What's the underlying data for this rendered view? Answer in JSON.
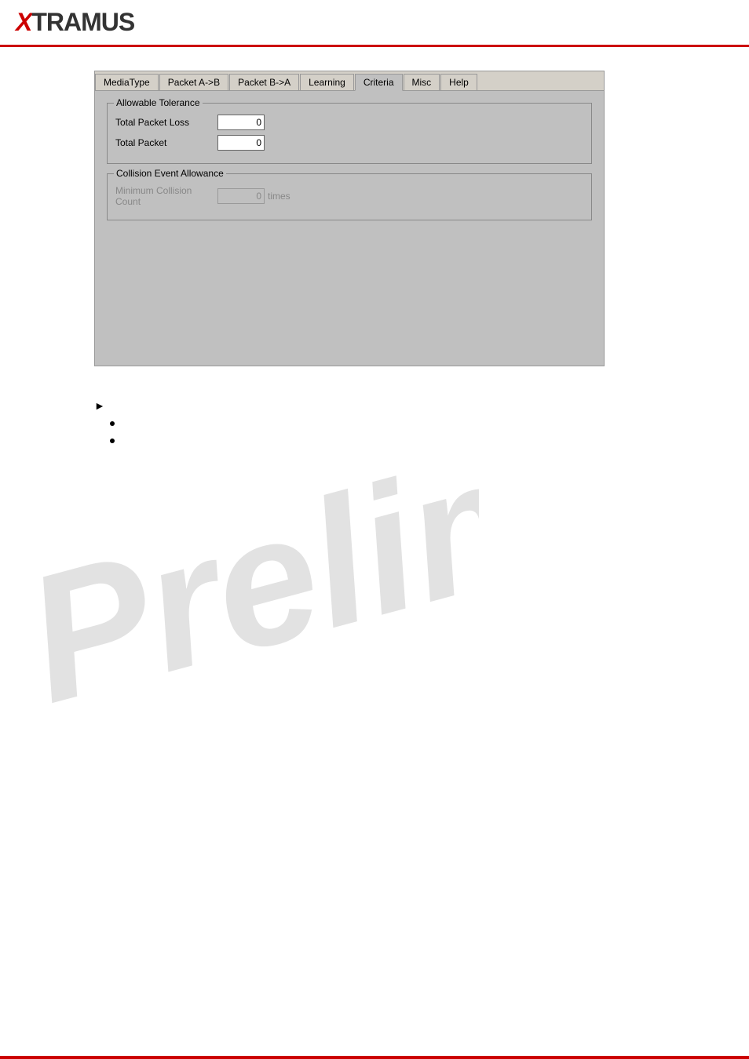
{
  "header": {
    "logo_x": "X",
    "logo_rest": "TRAMUS"
  },
  "tabs": {
    "items": [
      {
        "id": "mediatype",
        "label": "MediaType"
      },
      {
        "id": "packet-ab",
        "label": "Packet A->B"
      },
      {
        "id": "packet-ba",
        "label": "Packet B->A"
      },
      {
        "id": "learning",
        "label": "Learning"
      },
      {
        "id": "criteria",
        "label": "Criteria"
      },
      {
        "id": "misc",
        "label": "Misc"
      },
      {
        "id": "help",
        "label": "Help"
      }
    ],
    "active": "criteria"
  },
  "criteria_tab": {
    "allowable_tolerance_label": "Allowable Tolerance",
    "total_packet_loss_label": "Total Packet Loss",
    "total_packet_loss_value": "0",
    "total_packet_label": "Total Packet",
    "total_packet_value": "0",
    "collision_event_allowance_label": "Collision Event Allowance",
    "minimum_collision_count_label": "Minimum Collision Count",
    "minimum_collision_count_value": "0",
    "minimum_collision_count_unit": "times"
  },
  "watermark": {
    "text": "Prelim"
  },
  "bullet_items": [
    {
      "text": ""
    },
    {
      "text": ""
    }
  ]
}
